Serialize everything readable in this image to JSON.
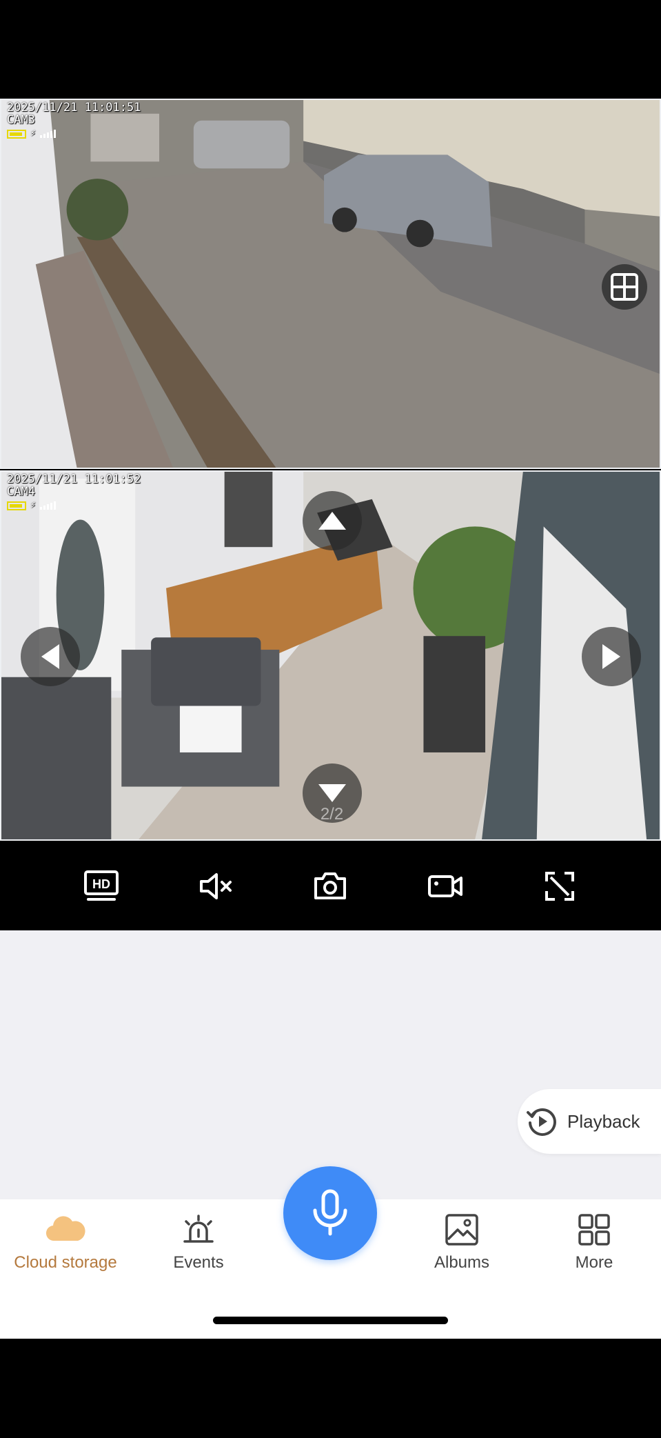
{
  "camera_1": {
    "timestamp": "2025/11/21 11:01:51",
    "name": "CAM3"
  },
  "camera_2": {
    "timestamp": "2025/11/21 11:01:52",
    "name": "CAM4"
  },
  "pagination": {
    "indicator": "2/2"
  },
  "toolbar": {
    "hd_icon": "hd-icon",
    "mute_icon": "speaker-muted-icon",
    "snapshot_icon": "camera-icon",
    "record_icon": "video-camera-icon",
    "fullscreen_icon": "expand-icon"
  },
  "playback": {
    "label": "Playback",
    "icon": "history-clock-icon"
  },
  "tabs": {
    "cloud_storage": "Cloud storage",
    "events": "Events",
    "albums": "Albums",
    "more": "More"
  },
  "colors": {
    "accent_blue": "#3f8bf7",
    "cloud_orange": "#b4793d",
    "content_bg": "#f0f0f4"
  }
}
